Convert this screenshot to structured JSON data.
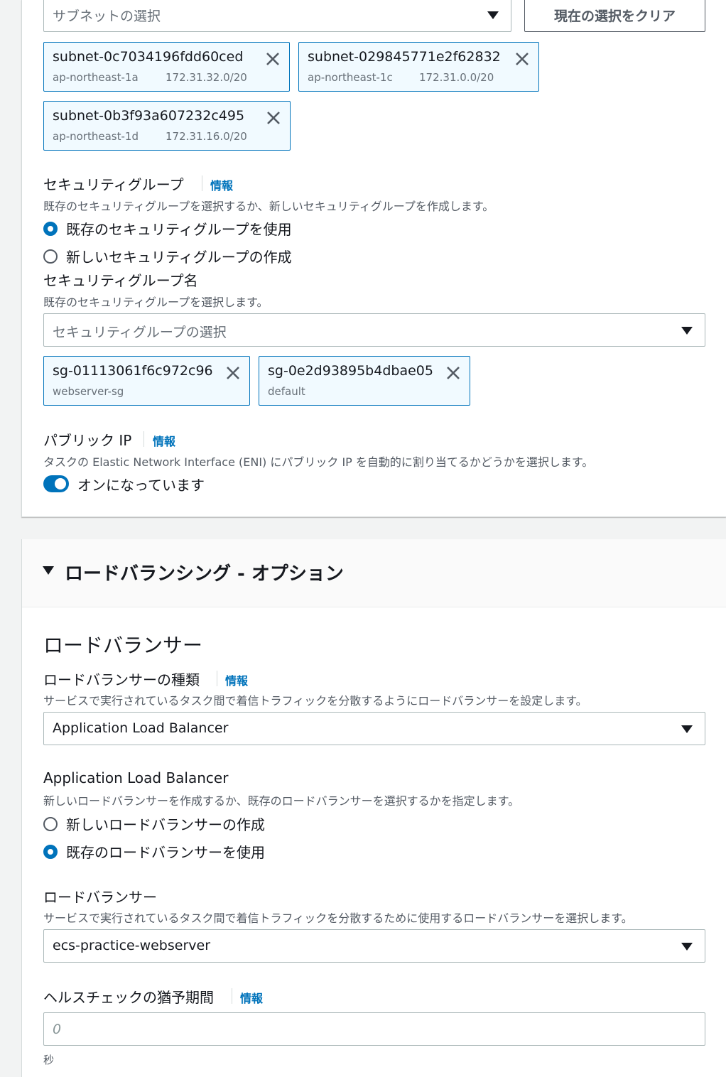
{
  "subnet": {
    "placeholder": "サブネットの選択",
    "clear_button": "現在の選択をクリア",
    "tokens": [
      {
        "id": "subnet-0c7034196fdd60ced",
        "az": "ap-northeast-1a",
        "cidr": "172.31.32.0/20"
      },
      {
        "id": "subnet-029845771e2f62832",
        "az": "ap-northeast-1c",
        "cidr": "172.31.0.0/20"
      },
      {
        "id": "subnet-0b3f93a607232c495",
        "az": "ap-northeast-1d",
        "cidr": "172.31.16.0/20"
      }
    ]
  },
  "security_group": {
    "label": "セキュリティグループ",
    "info": "情報",
    "description": "既存のセキュリティグループを選択するか、新しいセキュリティグループを作成します。",
    "options": [
      {
        "label": "既存のセキュリティグループを使用",
        "checked": true
      },
      {
        "label": "新しいセキュリティグループの作成",
        "checked": false
      }
    ],
    "name_label": "セキュリティグループ名",
    "name_description": "既存のセキュリティグループを選択します。",
    "placeholder": "セキュリティグループの選択",
    "tokens": [
      {
        "id": "sg-01113061f6c972c96",
        "name": "webserver-sg"
      },
      {
        "id": "sg-0e2d93895b4dbae05",
        "name": "default"
      }
    ]
  },
  "public_ip": {
    "label": "パブリック IP",
    "info": "情報",
    "description": "タスクの Elastic Network Interface (ENI) にパブリック IP を自動的に割り当てるかどうかを選択します。",
    "toggle_label": "オンになっています",
    "enabled": true
  },
  "load_balancing": {
    "section_title": "ロードバランシング - オプション",
    "heading": "ロードバランサー",
    "type_label": "ロードバランサーの種類",
    "type_info": "情報",
    "type_description": "サービスで実行されているタスク間で着信トラフィックを分散するようにロードバランサーを設定します。",
    "type_value": "Application Load Balancer",
    "alb_label": "Application Load Balancer",
    "alb_description": "新しいロードバランサーを作成するか、既存のロードバランサーを選択するかを指定します。",
    "alb_options": [
      {
        "label": "新しいロードバランサーの作成",
        "checked": false
      },
      {
        "label": "既存のロードバランサーを使用",
        "checked": true
      }
    ],
    "lb_label": "ロードバランサー",
    "lb_description": "サービスで実行されているタスク間で着信トラフィックを分散するために使用するロードバランサーを選択します。",
    "lb_value": "ecs-practice-webserver",
    "grace_label": "ヘルスチェックの猶予期間",
    "grace_info": "情報",
    "grace_placeholder": "0",
    "grace_unit": "秒"
  },
  "colors": {
    "accent": "#0073bb",
    "token_bg": "#f1faff",
    "page_bg": "#f2f3f3"
  }
}
